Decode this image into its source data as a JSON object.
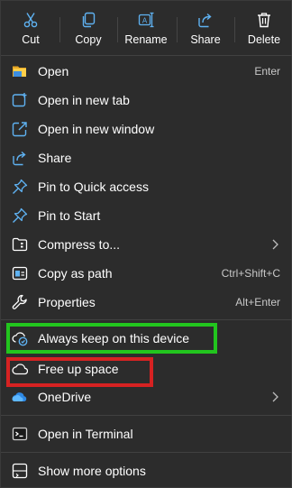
{
  "toolbar": {
    "cut": "Cut",
    "copy": "Copy",
    "rename": "Rename",
    "share": "Share",
    "delete": "Delete"
  },
  "menu": {
    "open": {
      "label": "Open",
      "shortcut": "Enter"
    },
    "open_new_tab": {
      "label": "Open in new tab"
    },
    "open_new_window": {
      "label": "Open in new window"
    },
    "share": {
      "label": "Share"
    },
    "pin_quick_access": {
      "label": "Pin to Quick access"
    },
    "pin_start": {
      "label": "Pin to Start"
    },
    "compress": {
      "label": "Compress to..."
    },
    "copy_path": {
      "label": "Copy as path",
      "shortcut": "Ctrl+Shift+C"
    },
    "properties": {
      "label": "Properties",
      "shortcut": "Alt+Enter"
    },
    "always_keep": {
      "label": "Always keep on this device"
    },
    "free_up": {
      "label": "Free up space"
    },
    "onedrive": {
      "label": "OneDrive"
    },
    "terminal": {
      "label": "Open in Terminal"
    },
    "more_options": {
      "label": "Show more options"
    }
  },
  "colors": {
    "accent_blue": "#5fb2f2",
    "highlight_green": "#22c51e",
    "highlight_red": "#d62222",
    "menu_background": "#2c2c2c"
  }
}
